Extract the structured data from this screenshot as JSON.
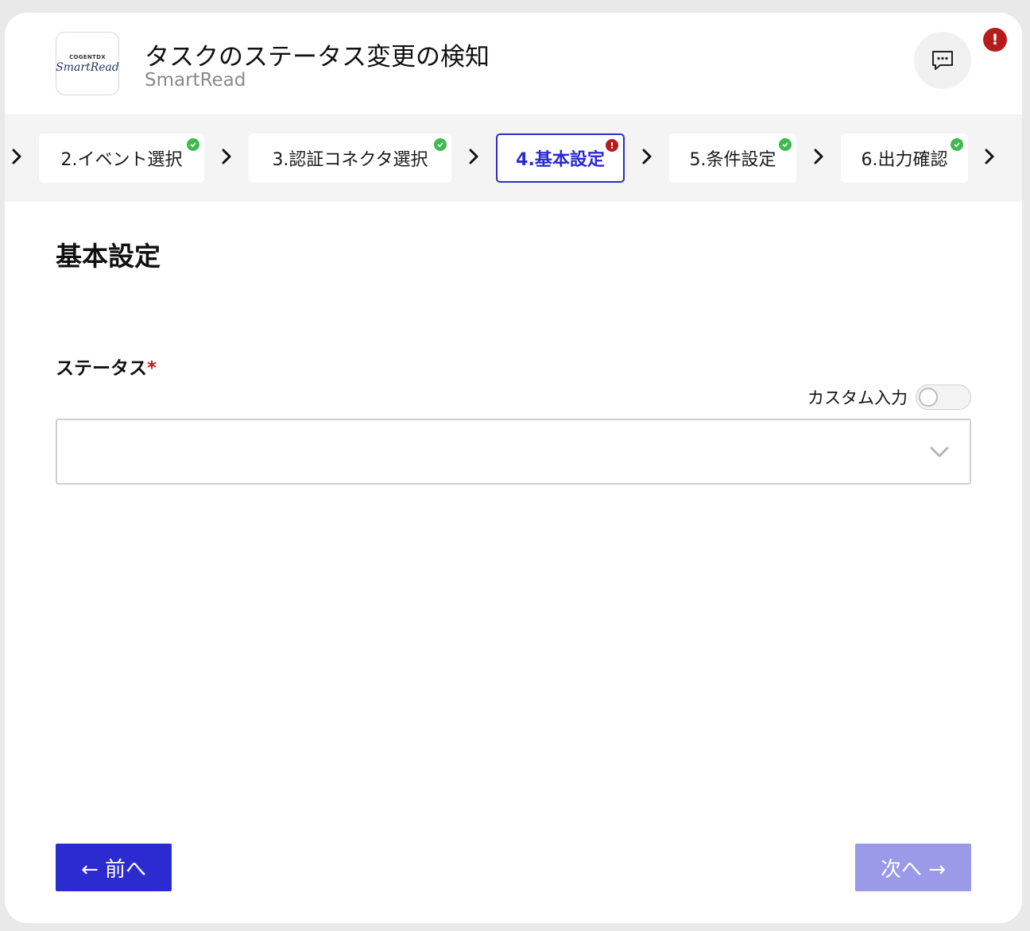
{
  "header": {
    "logo_top": "COGENTDX",
    "logo_main": "SmartRead",
    "title": "タスクのステータス変更の検知",
    "subtitle": "SmartRead",
    "alert_badge": "!"
  },
  "stepper": {
    "steps": [
      {
        "label": "2.イベント選択",
        "status": "complete"
      },
      {
        "label": "3.認証コネクタ選択",
        "status": "complete"
      },
      {
        "label": "4.基本設定",
        "status": "error",
        "active": true
      },
      {
        "label": "5.条件設定",
        "status": "complete"
      },
      {
        "label": "6.出力確認",
        "status": "complete"
      }
    ],
    "error_mark": "!"
  },
  "main": {
    "section_title": "基本設定",
    "status_field": {
      "label": "ステータス",
      "required_mark": "*",
      "custom_input_label": "カスタム入力",
      "custom_input_enabled": false,
      "value": ""
    }
  },
  "footer": {
    "prev_label": "← 前へ",
    "next_label": "次へ →"
  },
  "colors": {
    "accent": "#2c2bd2",
    "accent_disabled": "#9a9ae9",
    "success": "#3fb950",
    "error": "#b71c1c"
  }
}
